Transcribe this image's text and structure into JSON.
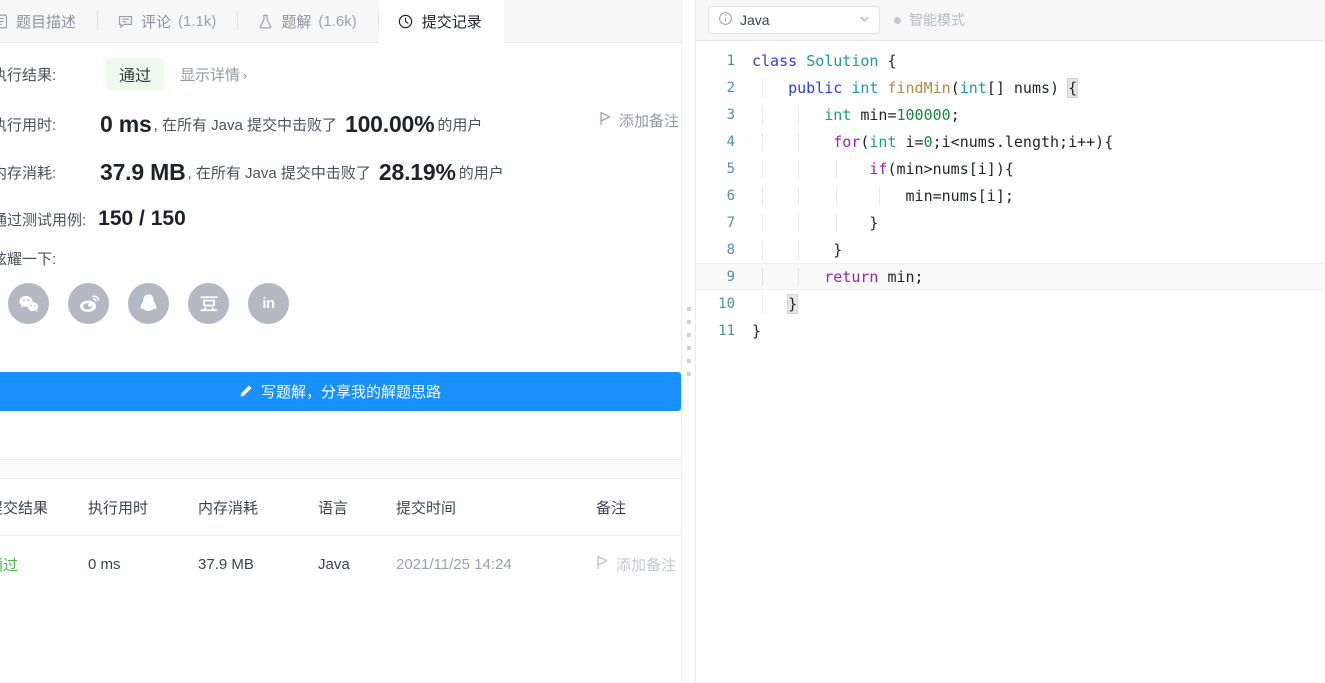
{
  "tabs": [
    {
      "label": "题目描述",
      "count": "",
      "icon": "document-icon",
      "active": false
    },
    {
      "label": "评论",
      "count": "(1.1k)",
      "icon": "comment-icon",
      "active": false
    },
    {
      "label": "题解",
      "count": "(1.6k)",
      "icon": "flask-icon",
      "active": false
    },
    {
      "label": "提交记录",
      "count": "",
      "icon": "clock-icon",
      "active": true
    }
  ],
  "result": {
    "exec_result_label": "执行结果:",
    "status": "通过",
    "detail_link": "显示详情",
    "detail_chevron": "›",
    "add_note_top": "添加备注",
    "exec_time_label": "执行用时:",
    "exec_time_value": "0 ms",
    "exec_time_mid": ", 在所有 Java 提交中击败了",
    "exec_time_percent": "100.00%",
    "exec_time_suffix": "的用户",
    "memory_label": "内存消耗:",
    "memory_value": "37.9 MB",
    "memory_mid": ", 在所有 Java 提交中击败了",
    "memory_percent": "28.19%",
    "memory_suffix": "的用户",
    "cases_label": "通过测试用例:",
    "cases_value": "150 / 150"
  },
  "share": {
    "label": "炫耀一下:",
    "buttons": [
      {
        "name": "wechat-icon"
      },
      {
        "name": "weibo-icon"
      },
      {
        "name": "qq-icon"
      },
      {
        "name": "douban-icon"
      },
      {
        "name": "linkedin-icon",
        "text": "in"
      }
    ]
  },
  "write_button": {
    "label": "写题解，分享我的解题思路",
    "icon": "pencil-icon",
    "color": "#1890ff"
  },
  "table": {
    "headers": [
      "提交结果",
      "执行用时",
      "内存消耗",
      "语言",
      "提交时间",
      "备注"
    ],
    "rows": [
      {
        "status": "通过",
        "time": "0 ms",
        "memory": "37.9 MB",
        "language": "Java",
        "submitted_at": "2021/11/25 14:24",
        "note": "添加备注"
      }
    ],
    "status_color": "#53b653"
  },
  "editor": {
    "language": "Java",
    "language_icon": "info-icon",
    "chevron": "⌄",
    "smart_mode": "智能模式",
    "lines": [
      {
        "n": "1",
        "text": "class Solution {"
      },
      {
        "n": "2",
        "text": "    public int findMin(int[] nums) {"
      },
      {
        "n": "3",
        "text": "        int min=100000;"
      },
      {
        "n": "4",
        "text": "        for(int i=0;i<nums.length;i++){"
      },
      {
        "n": "5",
        "text": "            if(min>nums[i]){"
      },
      {
        "n": "6",
        "text": "                min=nums[i];"
      },
      {
        "n": "7",
        "text": "            }"
      },
      {
        "n": "8",
        "text": "        }"
      },
      {
        "n": "9",
        "text": "        return min;"
      },
      {
        "n": "10",
        "text": "    }"
      },
      {
        "n": "11",
        "text": "}"
      }
    ]
  }
}
